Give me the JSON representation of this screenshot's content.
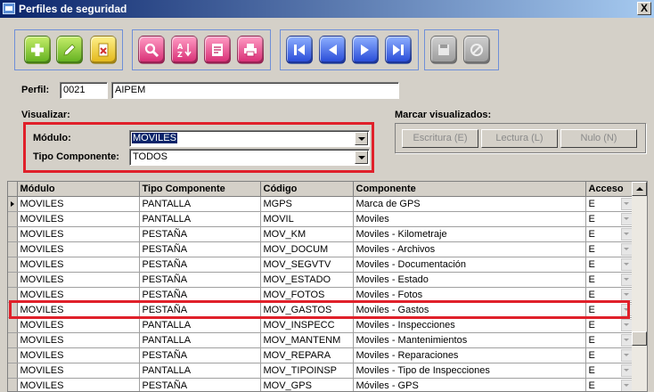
{
  "window": {
    "title": "Perfiles de seguridad",
    "close_glyph": "X"
  },
  "toolbar": {
    "groups": [
      [
        "add-icon",
        "edit-icon",
        "delete-icon"
      ],
      [
        "search-icon",
        "sort-az-icon",
        "report-icon",
        "print-icon"
      ],
      [
        "first-record-icon",
        "previous-record-icon",
        "next-record-icon",
        "last-record-icon"
      ],
      [
        "save-icon",
        "cancel-icon"
      ]
    ]
  },
  "perfil": {
    "label": "Perfil:",
    "code": "0021",
    "name": "AIPEM"
  },
  "visualizar": {
    "label": "Visualizar:",
    "modulo_label": "Módulo:",
    "modulo_value": "MOVILES",
    "tipo_label": "Tipo Componente:",
    "tipo_value": "TODOS"
  },
  "marcar": {
    "label": "Marcar visualizados:",
    "buttons": [
      "Escritura (E)",
      "Lectura (L)",
      "Nulo (N)"
    ]
  },
  "grid": {
    "columns": [
      "Módulo",
      "Tipo Componente",
      "Código",
      "Componente",
      "Acceso"
    ],
    "rows": [
      [
        "MOVILES",
        "PANTALLA",
        "MGPS",
        "Marca de GPS",
        "E"
      ],
      [
        "MOVILES",
        "PANTALLA",
        "MOVIL",
        "Moviles",
        "E"
      ],
      [
        "MOVILES",
        "PESTAÑA",
        "MOV_KM",
        "Moviles -  Kilometraje",
        "E"
      ],
      [
        "MOVILES",
        "PESTAÑA",
        "MOV_DOCUM",
        "Moviles - Archivos",
        "E"
      ],
      [
        "MOVILES",
        "PESTAÑA",
        "MOV_SEGVTV",
        "Moviles - Documentación",
        "E"
      ],
      [
        "MOVILES",
        "PESTAÑA",
        "MOV_ESTADO",
        "Moviles - Estado",
        "E"
      ],
      [
        "MOVILES",
        "PESTAÑA",
        "MOV_FOTOS",
        "Moviles - Fotos",
        "E"
      ],
      [
        "MOVILES",
        "PESTAÑA",
        "MOV_GASTOS",
        "Moviles - Gastos",
        "E"
      ],
      [
        "MOVILES",
        "PANTALLA",
        "MOV_INSPECC",
        "Moviles - Inspecciones",
        "E"
      ],
      [
        "MOVILES",
        "PANTALLA",
        "MOV_MANTENM",
        "Moviles - Mantenimientos",
        "E"
      ],
      [
        "MOVILES",
        "PESTAÑA",
        "MOV_REPARA",
        "Moviles - Reparaciones",
        "E"
      ],
      [
        "MOVILES",
        "PANTALLA",
        "MOV_TIPOINSP",
        "Moviles - Tipo de Inspecciones",
        "E"
      ],
      [
        "MOVILES",
        "PESTAÑA",
        "MOV_GPS",
        "Móviles - GPS",
        "E"
      ]
    ],
    "current_row": 0,
    "highlighted_row": 7
  },
  "colors": {
    "highlight": "#e0202a",
    "title_start": "#0a246a",
    "title_end": "#a6caf0"
  }
}
